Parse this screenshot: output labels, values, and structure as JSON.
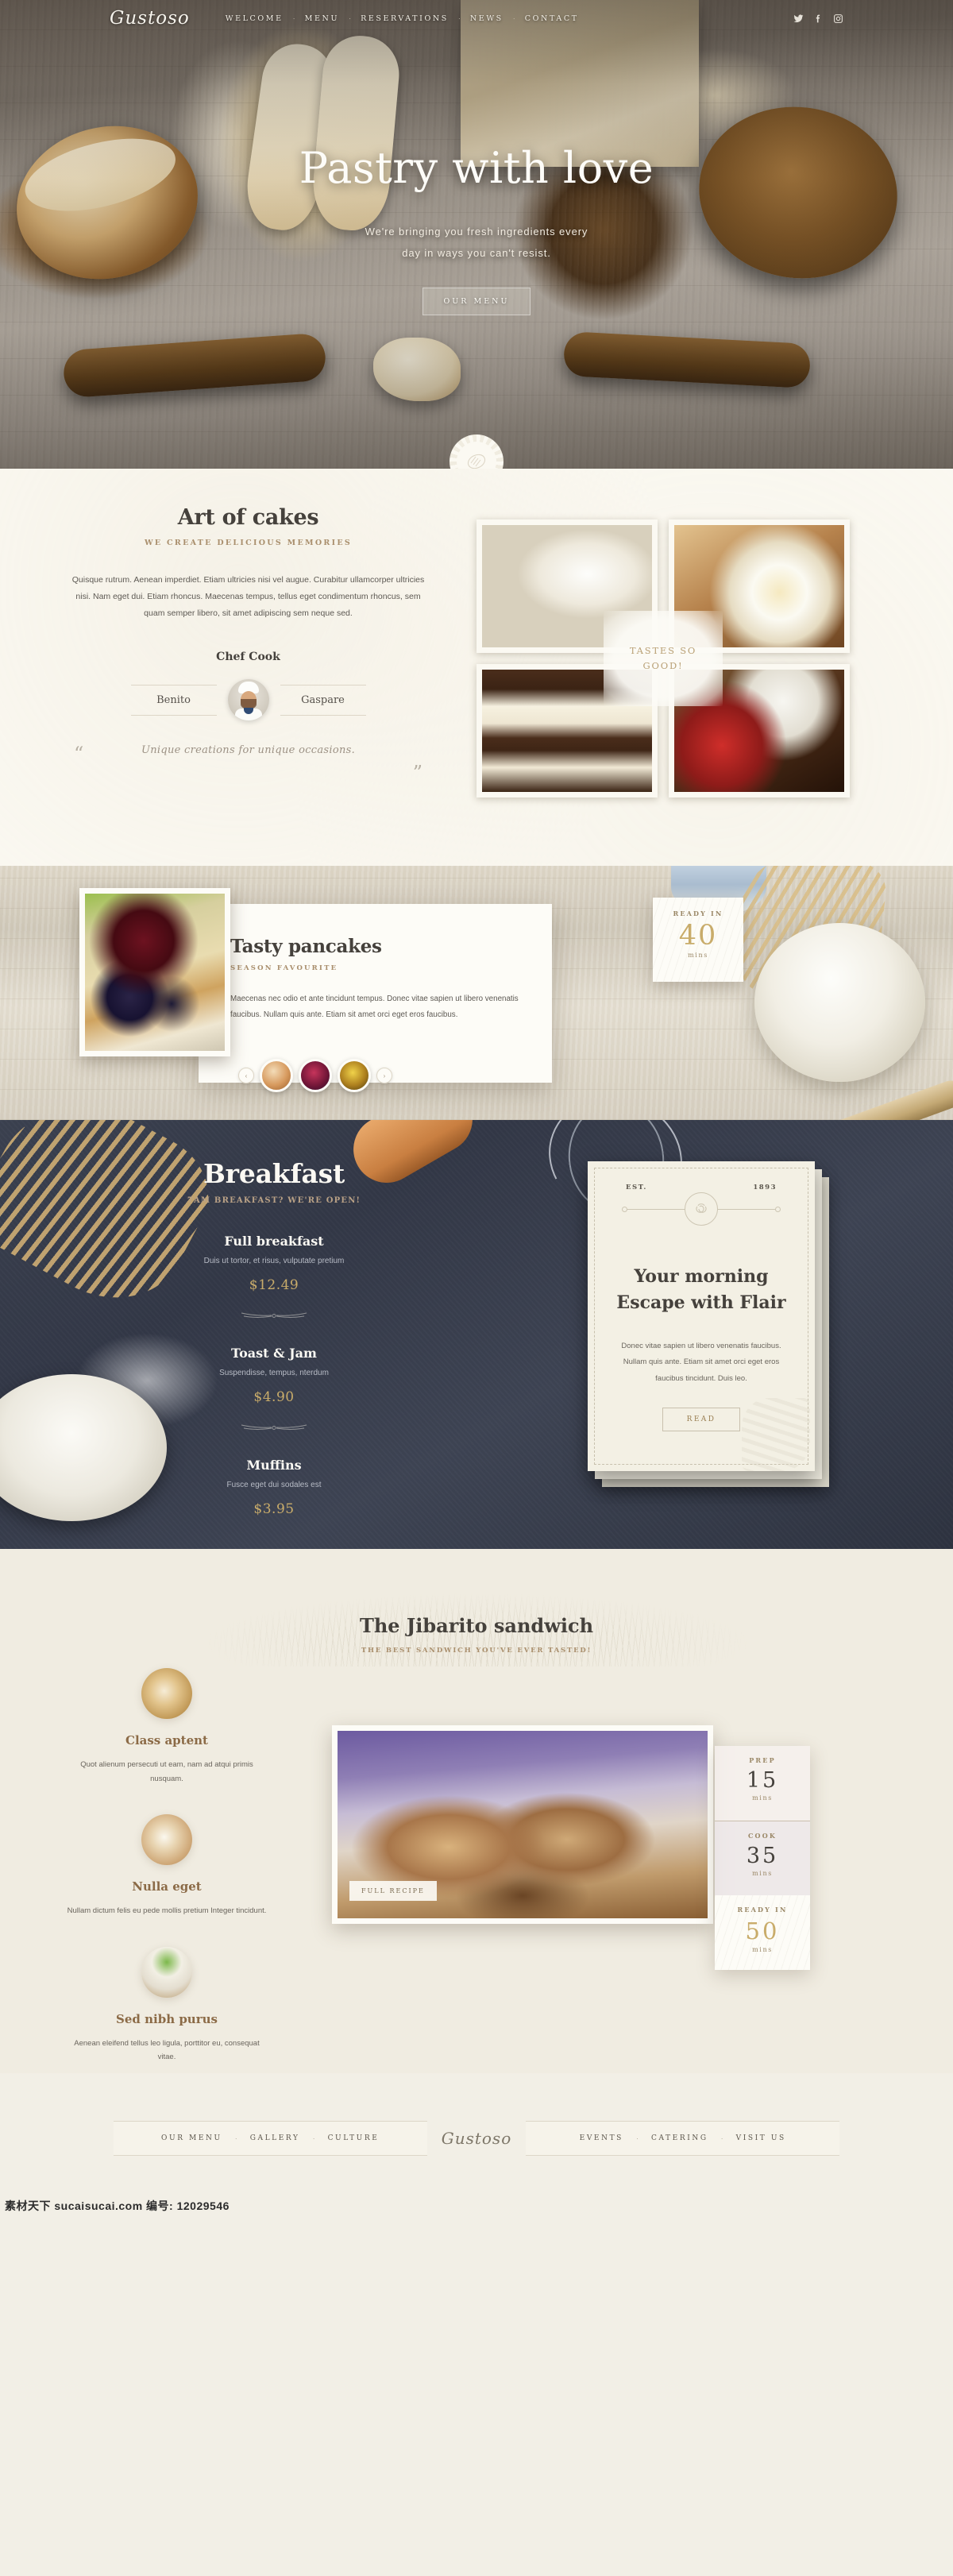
{
  "brand": {
    "name": "Gustoso"
  },
  "nav": {
    "items": [
      "WELCOME",
      "MENU",
      "RESERVATIONS",
      "NEWS",
      "CONTACT"
    ],
    "separator": "·",
    "socials": [
      "twitter-icon",
      "facebook-icon",
      "instagram-icon"
    ]
  },
  "hero": {
    "title": "Pastry with love",
    "subtitle_line1": "We're bringing you fresh ingredients every",
    "subtitle_line2": "day in ways you can't resist.",
    "button": "OUR MENU"
  },
  "cakes": {
    "title": "Art of cakes",
    "kicker": "WE CREATE DELICIOUS MEMORIES",
    "body": "Quisque rutrum. Aenean imperdiet. Etiam ultricies nisi vel augue. Curabitur ullamcorper ultricies nisi. Nam eget dui. Etiam rhoncus. Maecenas tempus, tellus eget condimentum rhoncus, sem quam semper libero, sit amet adipiscing sem neque sed.",
    "chef_heading": "Chef Cook",
    "chef_left": "Benito",
    "chef_right": "Gaspare",
    "quote_open": "“",
    "quote_close": "”",
    "quote": "Unique creations for unique occasions.",
    "gallery_badge_line1": "TASTES SO",
    "gallery_badge_line2": "GOOD!"
  },
  "pancakes": {
    "title": "Tasty pancakes",
    "kicker": "SEASON FAVOURITE",
    "body": "Maecenas nec odio et ante tincidunt tempus. Donec vitae sapien ut libero venenatis faucibus. Nullam quis ante. Etiam sit amet orci eget eros faucibus.",
    "prev_arrow": "‹",
    "next_arrow": "›",
    "ready": {
      "label": "READY IN",
      "value": "40",
      "unit": "mins"
    }
  },
  "breakfast": {
    "title": "Breakfast",
    "kicker": "7AM BREAKFAST? WE'RE OPEN!",
    "items": [
      {
        "name": "Full breakfast",
        "desc": "Duis ut tortor, et risus, vulputate pretium",
        "price": "$12.49"
      },
      {
        "name": "Toast & Jam",
        "desc": "Suspendisse, tempus, nterdum",
        "price": "$4.90"
      },
      {
        "name": "Muffins",
        "desc": "Fusce eget dui sodales est",
        "price": "$3.95"
      }
    ],
    "card": {
      "est_label": "EST.",
      "est_year": "1893",
      "title_line1": "Your morning",
      "title_line2": "Escape with Flair",
      "body": "Donec vitae sapien ut libero venenatis faucibus. Nullam quis ante. Etiam sit amet orci eget eros faucibus tincidunt. Duis leo.",
      "button": "READ"
    }
  },
  "jibarito": {
    "title": "The Jibarito sandwich",
    "kicker": "THE BEST SANDWICH YOU'VE EVER TASTED!",
    "features": [
      {
        "heading": "Class aptent",
        "text": "Quot alienum persecuti ut eam, nam ad atqui primis nusquam."
      },
      {
        "heading": "Nulla eget",
        "text": "Nullam dictum felis eu pede mollis pretium Integer tincidunt."
      },
      {
        "heading": "Sed nibh purus",
        "text": "Aenean eleifend tellus leo ligula, porttitor eu, consequat vitae."
      }
    ],
    "photo_button": "FULL RECIPE",
    "times": [
      {
        "label": "PREP",
        "value": "15",
        "unit": "mins"
      },
      {
        "label": "COOK",
        "value": "35",
        "unit": "mins"
      },
      {
        "label": "READY IN",
        "value": "50",
        "unit": "mins"
      }
    ]
  },
  "footer": {
    "left_links": [
      "OUR MENU",
      "GALLERY",
      "CULTURE"
    ],
    "right_links": [
      "EVENTS",
      "CATERING",
      "VISIT US"
    ],
    "separator": "·",
    "logo": "Gustoso",
    "watermark": "素材天下 sucaisucai.com 编号: 12029546"
  }
}
